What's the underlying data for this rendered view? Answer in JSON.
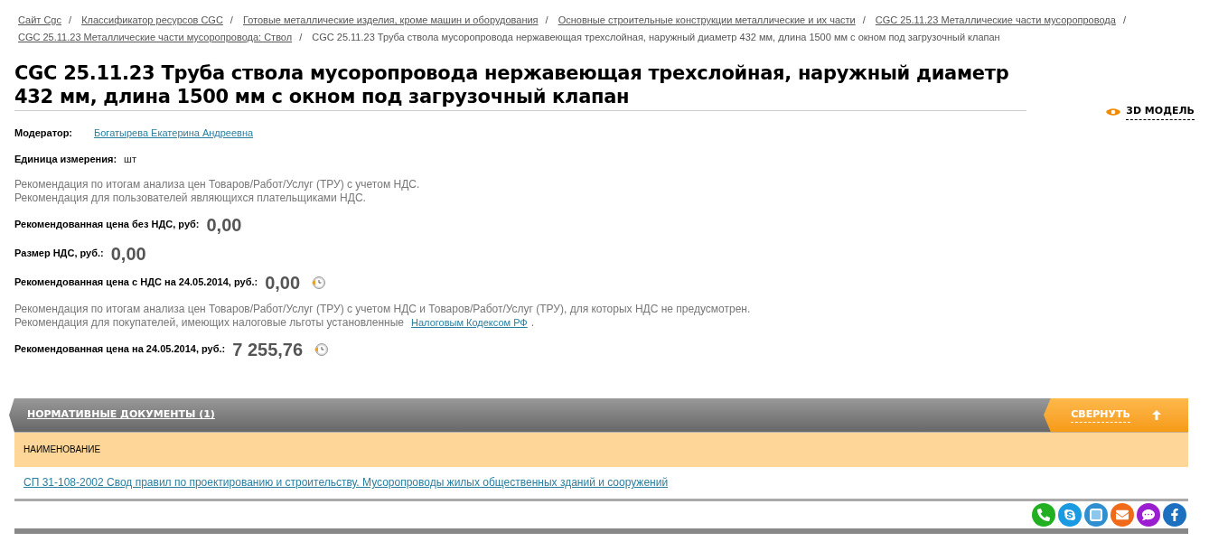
{
  "breadcrumbs": [
    {
      "text": "Сайт Cgc",
      "kind": "link",
      "sep": "/"
    },
    {
      "text": "Классификатор ресурсов CGC",
      "kind": "link",
      "sep": "/"
    },
    {
      "text": "Готовые металлические изделия, кроме машин и оборудования",
      "kind": "link",
      "sep": "/"
    },
    {
      "text": "Основные строительные конструкции металлические и их части",
      "kind": "link",
      "sep": "/"
    },
    {
      "text": "CGC 25.11.23 Металлические части мусоропровода",
      "kind": "link",
      "sep": "/"
    },
    {
      "text": "CGC 25.11.23 Металлические части мусоропровода: Ствол",
      "kind": "link",
      "sep": "/"
    },
    {
      "text": "CGC 25.11.23 Труба ствола мусоропровода нержавеющая трехслойная, наружный диаметр 432 мм, длина 1500 мм с окном под загрузочный клапан",
      "kind": "current"
    }
  ],
  "title": "CGC 25.11.23 Труба ствола мусоропровода нержавеющая трехслойная, наружный диаметр 432 мм, длина 1500 мм с окном под загрузочный клапан",
  "model_link": "3D МОДЕЛЬ",
  "blocks": [
    {
      "kind": "field",
      "label": "Модератор:",
      "value": "Богатырева Екатерина Андреевна",
      "link": true
    },
    {
      "kind": "field",
      "label": "Единица измерения:",
      "value": "шт",
      "link": false
    },
    {
      "kind": "note",
      "lines": [
        "Рекомендация по итогам анализа цен Товаров/Работ/Услуг (ТРУ) с учетом НДС.",
        "Рекомендация для пользователей являющихся плательщиками НДС."
      ]
    },
    {
      "kind": "price",
      "label": "Рекомендованная цена без НДС, руб:",
      "value": "0,00",
      "history": false
    },
    {
      "kind": "price",
      "label": "Размер НДС, руб.:",
      "value": "0,00",
      "history": false
    },
    {
      "kind": "price",
      "label": "Рекомендованная цена с НДС на 24.05.2014, руб.:",
      "value": "0,00",
      "history": true
    },
    {
      "kind": "note",
      "lines": [
        "Рекомендация по итогам анализа цен Товаров/Работ/Услуг (ТРУ) с учетом НДС и Товаров/Работ/Услуг (ТРУ), для которых НДС не предусмотрен.",
        "Рекомендация для покупателей, имеющих налоговые льготы установленные"
      ],
      "link": "Налоговым Кодексом РФ",
      "after": "."
    },
    {
      "kind": "price",
      "label": "Рекомендованная цена на 24.05.2014, руб.:",
      "value": "7 255,76",
      "history": true
    }
  ],
  "section": {
    "title": "НОРМАТИВНЫЕ ДОКУМЕНТЫ (1)",
    "toggle": "СВЕРНУТЬ",
    "expanded": true,
    "columns": [
      "НАИМЕНОВАНИЕ"
    ],
    "rows": [
      "СП 31-108-2002 Свод правил по проектированию и строительству. Мусоропроводы жилых общественных зданий и сооружений"
    ]
  }
}
